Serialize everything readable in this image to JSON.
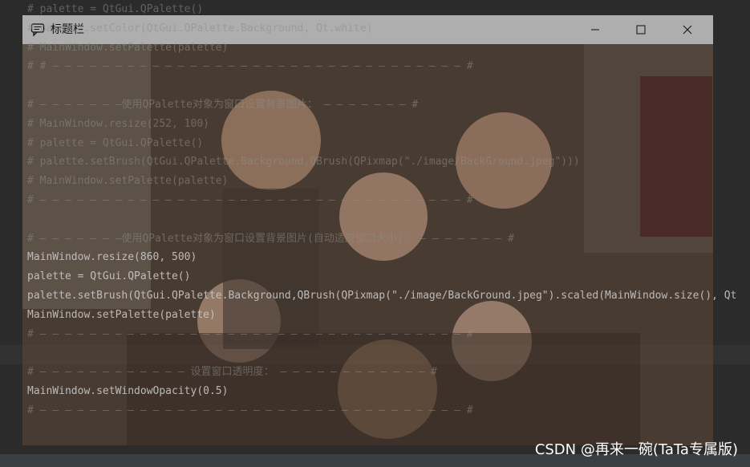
{
  "window": {
    "title": "标题栏",
    "background": "#ffffff",
    "opacity": 0.5
  },
  "photo": {
    "description_label": "group photo background image"
  },
  "editor": {
    "background": "#2b2b2b",
    "lines": [
      {
        "text": "# palette = QtGui.QPalette()",
        "active": false
      },
      {
        "text": "# palette.setColor(QtGui.QPalette.Background, Qt.white)",
        "active": false
      },
      {
        "text": "# MainWindow.setPalette(palette)",
        "active": false
      },
      {
        "text": "# # — — — — — — — — — — — — — — — — — — — — — — — — — — — — — — — — — #",
        "active": false
      },
      {
        "text": "",
        "active": false
      },
      {
        "text": "# — — — — — — —使用QPalette对象为窗口设置背景图片： — — — — — — — #",
        "active": false
      },
      {
        "text": "# MainWindow.resize(252, 100)",
        "active": false
      },
      {
        "text": "# palette = QtGui.QPalette()",
        "active": false
      },
      {
        "text": "# palette.setBrush(QtGui.QPalette.Background,QBrush(QPixmap(\"./image/BackGround.jpeg\")))",
        "active": false
      },
      {
        "text": "# MainWindow.setPalette(palette)",
        "active": false
      },
      {
        "text": "# — — — — — — — — — — — — — — — — — — — — — — — — — — — — — — — — — — #",
        "active": false
      },
      {
        "text": "",
        "active": false
      },
      {
        "text": "# — — — — — — —使用QPalette对象为窗口设置背景图片(自动适应窗口大小)： — — — — — — — #",
        "active": false
      },
      {
        "text": "MainWindow.resize(860, 500)",
        "active": true
      },
      {
        "text": "palette = QtGui.QPalette()",
        "active": true
      },
      {
        "text": "palette.setBrush(QtGui.QPalette.Background,QBrush(QPixmap(\"./image/BackGround.jpeg\").scaled(MainWindow.size(), Qt",
        "active": true
      },
      {
        "text": "MainWindow.setPalette(palette)",
        "active": true
      },
      {
        "text": "# — — — — — — — — — — — — — — — — — — — — — — — — — — — — — — — — — — #",
        "active": false
      },
      {
        "text": "",
        "active": false
      },
      {
        "text": "# — — — — — — — — — — — — 设置窗口透明度： — — — — — — — — — — — — #",
        "active": false
      },
      {
        "text": "MainWindow.setWindowOpacity(0.5)",
        "active": true
      },
      {
        "text": "# — — — — — — — — — — — — — — — — — — — — — — — — — — — — — — — — — — #",
        "active": false
      }
    ]
  },
  "watermark": "CSDN @再来一碗(TaTa专属版)"
}
